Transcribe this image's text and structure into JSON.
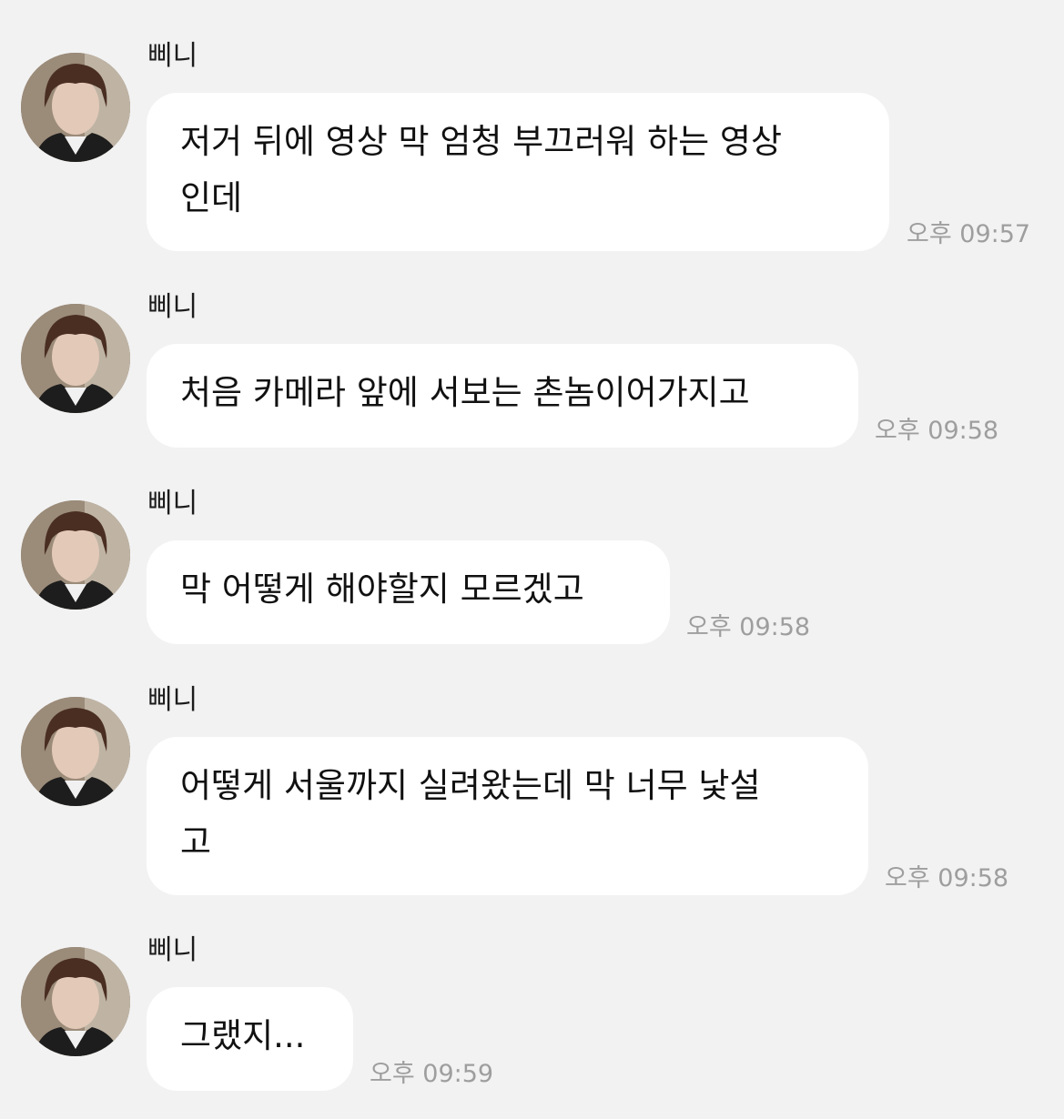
{
  "chat": {
    "messages": [
      {
        "sender": "삐니",
        "text": "저거 뒤에 영상 막 엄청 부끄러워 하는 영상\n인데",
        "time": "오후 09:57"
      },
      {
        "sender": "삐니",
        "text": "처음 카메라 앞에 서보는 촌놈이어가지고",
        "time": "오후 09:58"
      },
      {
        "sender": "삐니",
        "text": "막 어떻게 해야할지 모르겠고",
        "time": "오후 09:58"
      },
      {
        "sender": "삐니",
        "text": "어떻게 서울까지 실려왔는데 막 너무 낯설\n고",
        "time": "오후 09:58"
      },
      {
        "sender": "삐니",
        "text": "그랬지...",
        "time": "오후 09:59"
      }
    ]
  },
  "colors": {
    "background": "#f2f2f2",
    "bubble": "#ffffff",
    "timestamp": "#9e9e9e"
  }
}
